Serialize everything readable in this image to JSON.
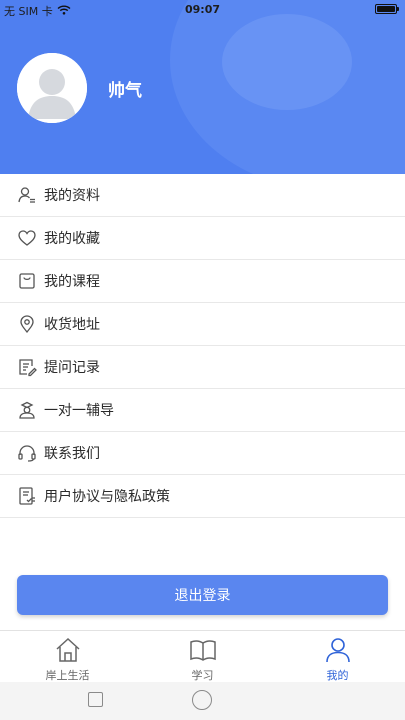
{
  "status_bar": {
    "carrier": "无 SIM 卡",
    "time": "09:07",
    "wifi_icon": "wifi-icon",
    "battery_icon": "battery-icon"
  },
  "header": {
    "background_color": "#4f7ff0",
    "avatar_icon": "user-avatar-icon",
    "username": "帅气"
  },
  "menu": {
    "items": [
      {
        "label": "我的资料",
        "icon": "profile-card-icon"
      },
      {
        "label": "我的收藏",
        "icon": "heart-icon"
      },
      {
        "label": "我的课程",
        "icon": "shopping-bag-icon"
      },
      {
        "label": "收货地址",
        "icon": "location-pin-icon"
      },
      {
        "label": "提问记录",
        "icon": "notes-edit-icon"
      },
      {
        "label": "一对一辅导",
        "icon": "tutor-icon"
      },
      {
        "label": "联系我们",
        "icon": "headset-icon"
      },
      {
        "label": "用户协议与隐私政策",
        "icon": "agreement-document-icon"
      }
    ]
  },
  "logout": {
    "label": "退出登录",
    "color": "#5a86ef"
  },
  "tabbar": {
    "active_color": "#2f63d8",
    "tabs": [
      {
        "label": "岸上生活",
        "icon": "home-icon",
        "active": false
      },
      {
        "label": "学习",
        "icon": "book-icon",
        "active": false
      },
      {
        "label": "我的",
        "icon": "person-icon",
        "active": true
      }
    ]
  },
  "system_nav": {
    "recents_icon": "recents-square-icon",
    "home_icon": "home-circle-icon"
  }
}
